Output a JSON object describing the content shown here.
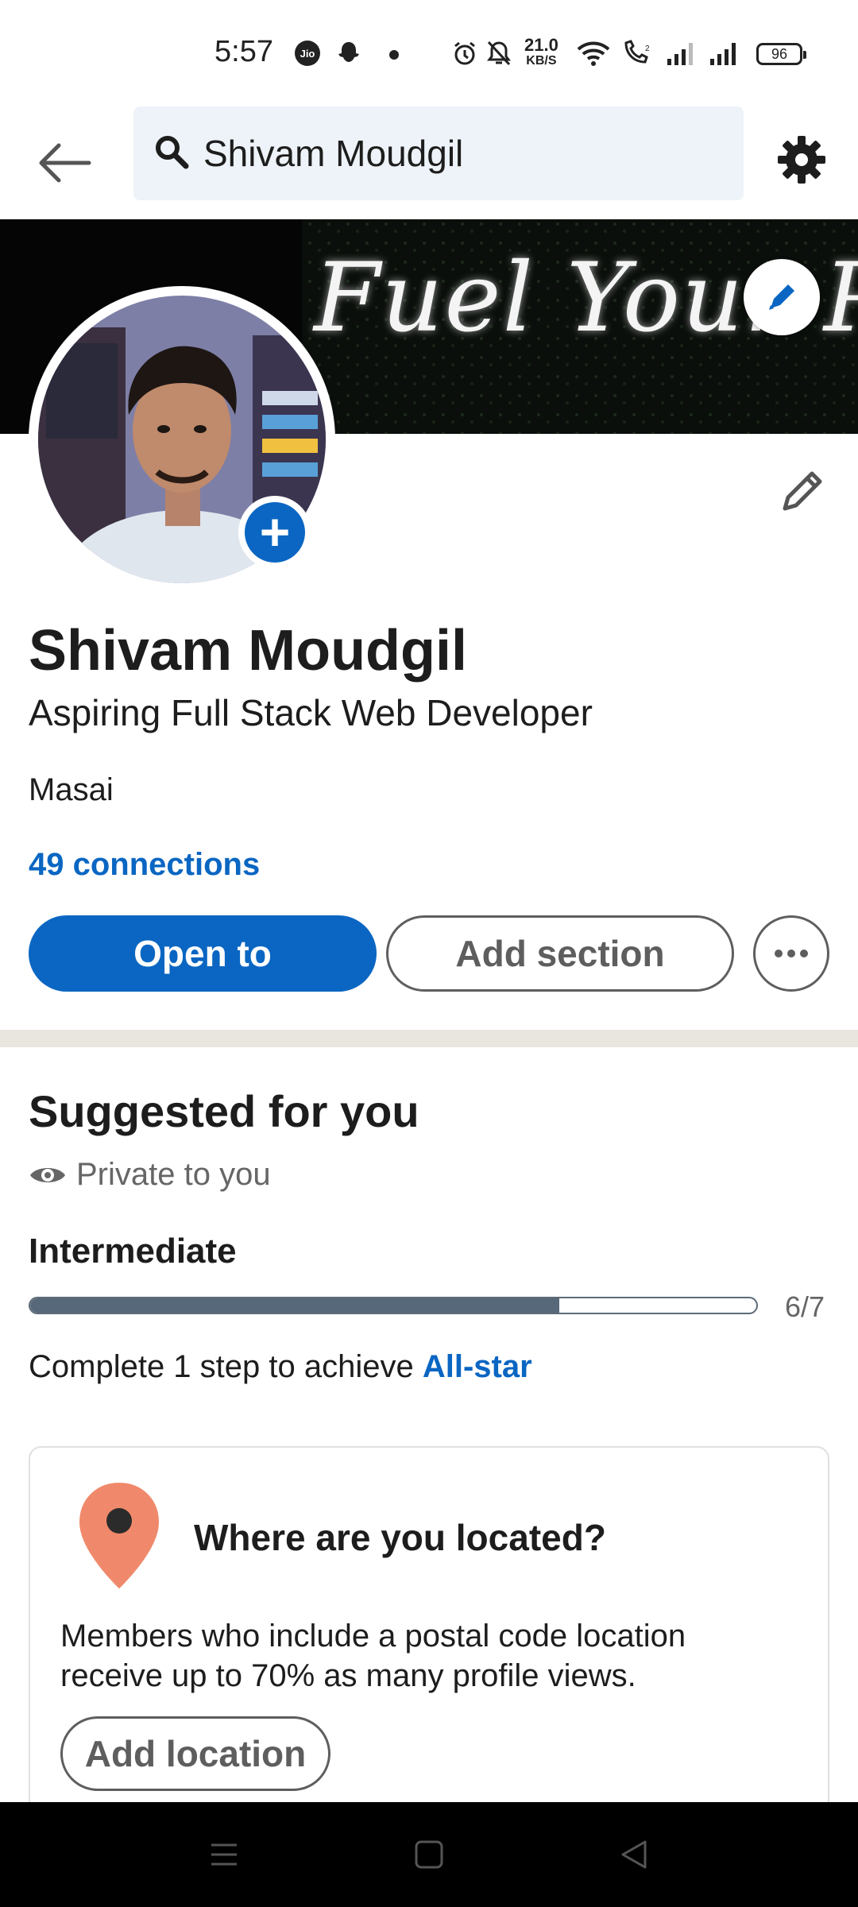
{
  "status_bar": {
    "time": "5:57",
    "speed_value": "21.0",
    "speed_unit": "KB/S",
    "battery": "96",
    "icons": [
      "jio-icon",
      "snapchat-icon",
      "dot-icon",
      "alarm-icon",
      "bell-off-icon",
      "wifi-icon",
      "volte-call-icon",
      "signal-icon",
      "signal-icon"
    ]
  },
  "topbar": {
    "search_text": "Shivam Moudgil",
    "icons": {
      "back": "arrow-left-icon",
      "search": "search-icon",
      "settings": "gear-icon"
    }
  },
  "banner": {
    "text": "Fuel Your Passion"
  },
  "profile": {
    "name": "Shivam Moudgil",
    "headline": "Aspiring Full Stack Web Developer",
    "company": "Masai",
    "connections": "49 connections",
    "open_to_label": "Open to",
    "add_section_label": "Add section"
  },
  "suggested": {
    "title": "Suggested for you",
    "visibility": "Private to you",
    "level": "Intermediate",
    "progress": {
      "completed": 6,
      "total": 7,
      "label": "6/7"
    },
    "complete_prefix": "Complete 1 step to achieve ",
    "complete_link": "All-star"
  },
  "location_card": {
    "title": "Where are you located?",
    "body": "Members who include a postal code location receive up to 70% as many profile views.",
    "button_label": "Add location"
  },
  "colors": {
    "brand_blue": "#0a66c2",
    "progress_fill": "#56687a",
    "pin_orange": "#f0896b",
    "divider": "#e9e5df"
  }
}
